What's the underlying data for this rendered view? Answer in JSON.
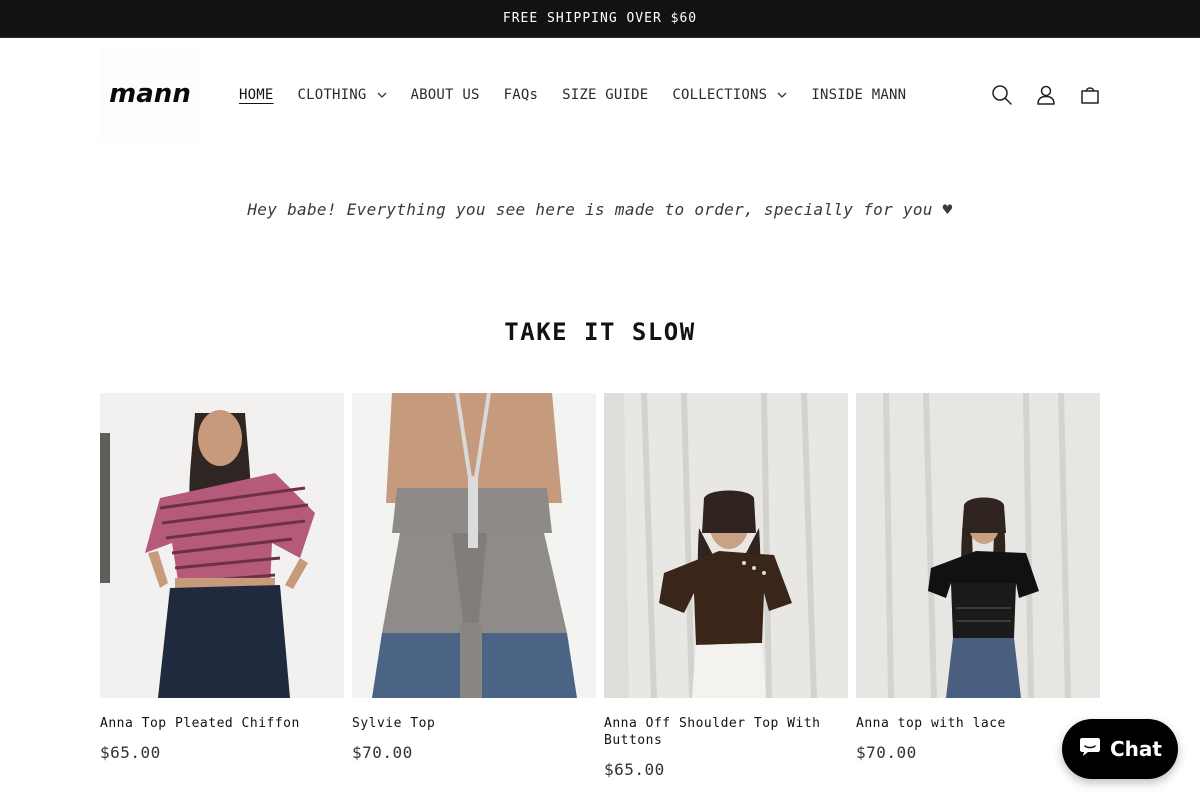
{
  "announcement": {
    "text": "FREE SHIPPING OVER $60"
  },
  "header": {
    "logo_text": "mann",
    "nav": [
      {
        "label": "HOME",
        "active": true,
        "dropdown": false
      },
      {
        "label": "CLOTHING",
        "active": false,
        "dropdown": true
      },
      {
        "label": "ABOUT US",
        "active": false,
        "dropdown": false
      },
      {
        "label": "FAQs",
        "active": false,
        "dropdown": false
      },
      {
        "label": "SIZE GUIDE",
        "active": false,
        "dropdown": false
      },
      {
        "label": "COLLECTIONS",
        "active": false,
        "dropdown": true
      },
      {
        "label": "INSIDE MANN",
        "active": false,
        "dropdown": false
      }
    ],
    "icons": [
      "search-icon",
      "account-icon",
      "cart-icon"
    ]
  },
  "tagline": "Hey babe! Everything you see here is made to order, specially for you ♥",
  "section": {
    "title": "TAKE IT SLOW",
    "products": [
      {
        "title": "Anna Top Pleated Chiffon",
        "price": "$65.00"
      },
      {
        "title": "Sylvie Top",
        "price": "$70.00"
      },
      {
        "title": "Anna Off Shoulder Top With Buttons",
        "price": "$65.00"
      },
      {
        "title": "Anna top with lace",
        "price": "$70.00"
      }
    ]
  },
  "chat": {
    "label": "Chat"
  },
  "colors": {
    "announcement_bg": "#121212",
    "text": "#121212",
    "chat_bg": "#000000"
  }
}
